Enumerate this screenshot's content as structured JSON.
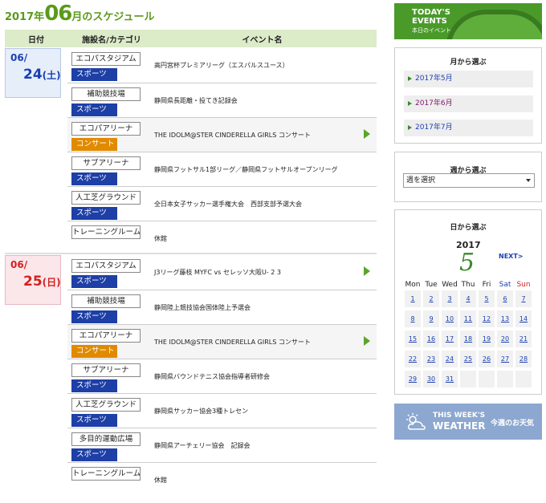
{
  "title": {
    "year": "2017年",
    "month": "06",
    "rest": "月のスケジュール"
  },
  "table_head": {
    "date": "日付",
    "facility": "施設名/カテゴリ",
    "event": "イベント名"
  },
  "days": [
    {
      "month": "06/",
      "day": "24",
      "weekday": "(土)",
      "rows": [
        {
          "facility": "エコパスタジアム",
          "category": "スポーツ",
          "event": "高円宮杯プレミアリーグ（エスパルスユース）"
        },
        {
          "facility": "補助競技場",
          "category": "スポーツ",
          "event": "静岡県長距離・投てき記録会"
        },
        {
          "facility": "エコパアリーナ",
          "category": "コンサート",
          "event": "THE IDOLM@STER CINDERELLA GIRLS コンサート"
        },
        {
          "facility": "サブアリーナ",
          "category": "スポーツ",
          "event": "静岡県フットサル1部リーグ／静岡県フットサルオープンリーグ"
        },
        {
          "facility": "人工芝グラウンド",
          "category": "スポーツ",
          "event": "全日本女子サッカー選手権大会　西部支部予選大会"
        },
        {
          "facility": "トレーニングルーム",
          "category": "",
          "event": "休館"
        }
      ]
    },
    {
      "month": "06/",
      "day": "25",
      "weekday": "(日)",
      "rows": [
        {
          "facility": "エコパスタジアム",
          "category": "スポーツ",
          "event": "J3リーグ藤枝 MYFC vs セレッソ大阪U- 2 3"
        },
        {
          "facility": "補助競技場",
          "category": "スポーツ",
          "event": "静岡陸上競技協会国体陸上予選会"
        },
        {
          "facility": "エコパアリーナ",
          "category": "コンサート",
          "event": "THE IDOLM@STER CINDERELLA GIRLS コンサート"
        },
        {
          "facility": "サブアリーナ",
          "category": "スポーツ",
          "event": "静岡県バウンドテニス協会指導者研修会"
        },
        {
          "facility": "人工芝グラウンド",
          "category": "スポーツ",
          "event": "静岡県サッカー協会3種トレセン"
        },
        {
          "facility": "多目的運動広場",
          "category": "スポーツ",
          "event": "静岡県アーチェリー協会　記録会"
        },
        {
          "facility": "トレーニングルーム",
          "category": "",
          "event": "休館"
        }
      ]
    }
  ],
  "today_banner": {
    "title": "TODAY'S EVENTS",
    "sub": "本日のイベント"
  },
  "month_panel": {
    "title": "月から選ぶ",
    "items": [
      "2017年5月",
      "2017年6月",
      "2017年7月"
    ]
  },
  "week_panel": {
    "title": "週から選ぶ",
    "select_value": "週を選択"
  },
  "day_panel": {
    "title": "日から選ぶ",
    "year": "2017",
    "month": "5",
    "next": "NEXT>",
    "weekdays": [
      "Mon",
      "Tue",
      "Wed",
      "Thu",
      "Fri",
      "Sat",
      "Sun"
    ],
    "weeks": [
      [
        "1",
        "2",
        "3",
        "4",
        "5",
        "6",
        "7"
      ],
      [
        "8",
        "9",
        "10",
        "11",
        "12",
        "13",
        "14"
      ],
      [
        "15",
        "16",
        "17",
        "18",
        "19",
        "20",
        "21"
      ],
      [
        "22",
        "23",
        "24",
        "25",
        "26",
        "27",
        "28"
      ],
      [
        "29",
        "30",
        "31",
        "",
        "",
        "",
        ""
      ]
    ]
  },
  "weather_banner": {
    "line1": "THIS WEEK'S",
    "line2": "WEATHER",
    "line3": "今週のお天気"
  },
  "colors": {
    "accent_green": "#5a9a1a",
    "sports": "#1d3fa6",
    "concert": "#e18a00",
    "link": "#1a3fb0",
    "sat": "#1a3fb0",
    "sun": "#d42020"
  }
}
